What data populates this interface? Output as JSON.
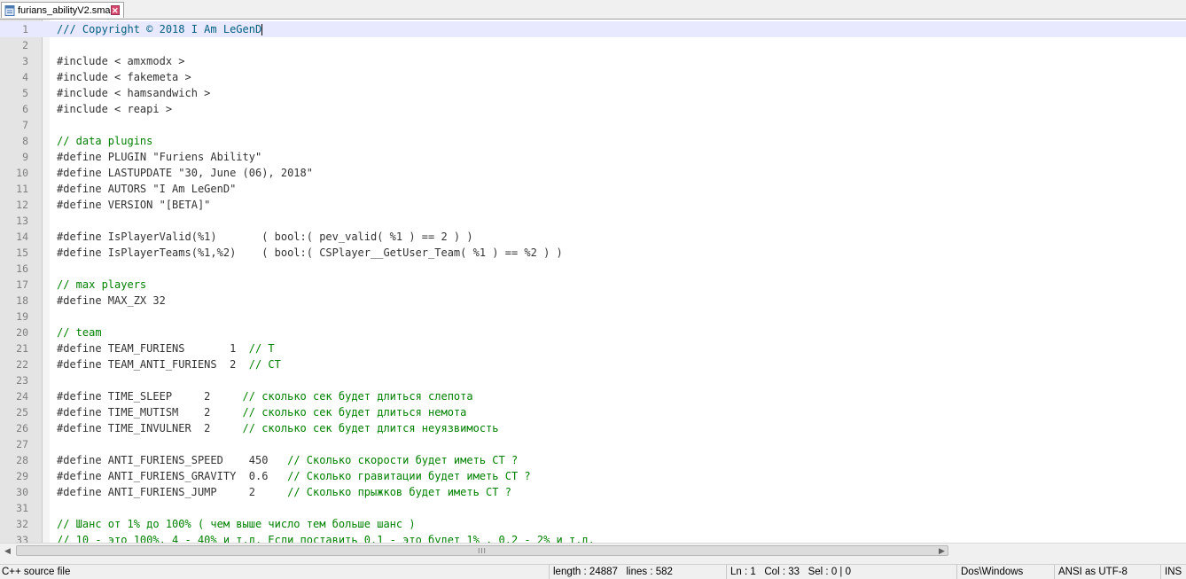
{
  "tab": {
    "title": "furians_abilityV2.sma",
    "close_symbol": "✕",
    "icon": "file-icon"
  },
  "editor": {
    "lines": [
      {
        "n": "1",
        "text": "/// Copyright © 2018 I Am LeGenD",
        "comment": true,
        "current": true
      },
      {
        "n": "2",
        "text": ""
      },
      {
        "n": "3",
        "text": "#include < amxmodx >"
      },
      {
        "n": "4",
        "text": "#include < fakemeta >"
      },
      {
        "n": "5",
        "text": "#include < hamsandwich >"
      },
      {
        "n": "6",
        "text": "#include < reapi >"
      },
      {
        "n": "7",
        "text": ""
      },
      {
        "n": "8",
        "text": "// data plugins",
        "comment": true
      },
      {
        "n": "9",
        "text": "#define PLUGIN \"Furiens Ability\""
      },
      {
        "n": "10",
        "text": "#define LASTUPDATE \"30, June (06), 2018\""
      },
      {
        "n": "11",
        "text": "#define AUTORS \"I Am LeGenD\""
      },
      {
        "n": "12",
        "text": "#define VERSION \"[BETA]\""
      },
      {
        "n": "13",
        "text": ""
      },
      {
        "n": "14",
        "text": "#define IsPlayerValid(%1)       ( bool:( pev_valid( %1 ) == 2 ) )"
      },
      {
        "n": "15",
        "text": "#define IsPlayerTeams(%1,%2)    ( bool:( CSPlayer__GetUser_Team( %1 ) == %2 ) )"
      },
      {
        "n": "16",
        "text": ""
      },
      {
        "n": "17",
        "text": "// max players",
        "comment": true
      },
      {
        "n": "18",
        "text": "#define MAX_ZX 32"
      },
      {
        "n": "19",
        "text": ""
      },
      {
        "n": "20",
        "text": "// team",
        "comment": true
      },
      {
        "n": "21",
        "text": "#define TEAM_FURIENS       1  ",
        "trail": "// T"
      },
      {
        "n": "22",
        "text": "#define TEAM_ANTI_FURIENS  2  ",
        "trail": "// CT"
      },
      {
        "n": "23",
        "text": ""
      },
      {
        "n": "24",
        "text": "#define TIME_SLEEP     2     ",
        "trail": "// сколько сек будет длиться слепота"
      },
      {
        "n": "25",
        "text": "#define TIME_MUTISM    2     ",
        "trail": "// сколько сек будет длиться немота"
      },
      {
        "n": "26",
        "text": "#define TIME_INVULNER  2     ",
        "trail": "// сколько сек будет длится неуязвимость"
      },
      {
        "n": "27",
        "text": ""
      },
      {
        "n": "28",
        "text": "#define ANTI_FURIENS_SPEED    450   ",
        "trail": "// Сколько скорости будет иметь CT ?"
      },
      {
        "n": "29",
        "text": "#define ANTI_FURIENS_GRAVITY  0.6   ",
        "trail": "// Сколько гравитации будет иметь CT ?"
      },
      {
        "n": "30",
        "text": "#define ANTI_FURIENS_JUMP     2     ",
        "trail": "// Сколько прыжков будет иметь CT ?"
      },
      {
        "n": "31",
        "text": ""
      },
      {
        "n": "32",
        "text": "// Шанс от 1% до 100% ( чем выше число тем больше шанс )",
        "comment": true
      },
      {
        "n": "33",
        "text": "// 10 - это 100%, 4 - 40% и т.д. Если поставить 0.1 - это будет 1% , 0.2 - 2% и т.д.",
        "comment": true
      }
    ]
  },
  "hscroll": {
    "left_arrow": "◀",
    "right_arrow": "▶",
    "grip": "III"
  },
  "status": {
    "file_type": "C++ source file",
    "length": "length : 24887",
    "lines": "lines : 582",
    "ln": "Ln : 1",
    "col": "Col : 33",
    "sel": "Sel : 0 | 0",
    "eol": "Dos\\Windows",
    "encoding": "ANSI as UTF-8",
    "mode": "INS"
  }
}
